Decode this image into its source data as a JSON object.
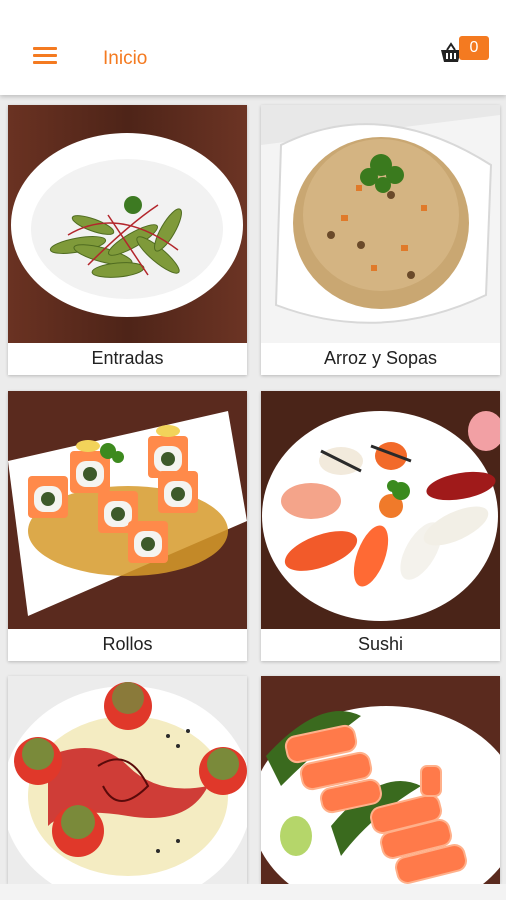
{
  "header": {
    "title": "Inicio",
    "cart_count": "0",
    "menu_icon": "hamburger-menu-icon",
    "cart_icon": "shopping-basket-icon"
  },
  "categories": [
    {
      "label": "Entradas",
      "image": "edamame-bowl"
    },
    {
      "label": "Arroz y Sopas",
      "image": "fried-rice-bowl"
    },
    {
      "label": "Rollos",
      "image": "salmon-rolls-plate"
    },
    {
      "label": "Sushi",
      "image": "sushi-plate"
    },
    {
      "label": "",
      "image": "tuna-tartare-plate"
    },
    {
      "label": "",
      "image": "salmon-sashimi-plate"
    }
  ],
  "colors": {
    "accent": "#f47a20",
    "background": "#ececec"
  }
}
